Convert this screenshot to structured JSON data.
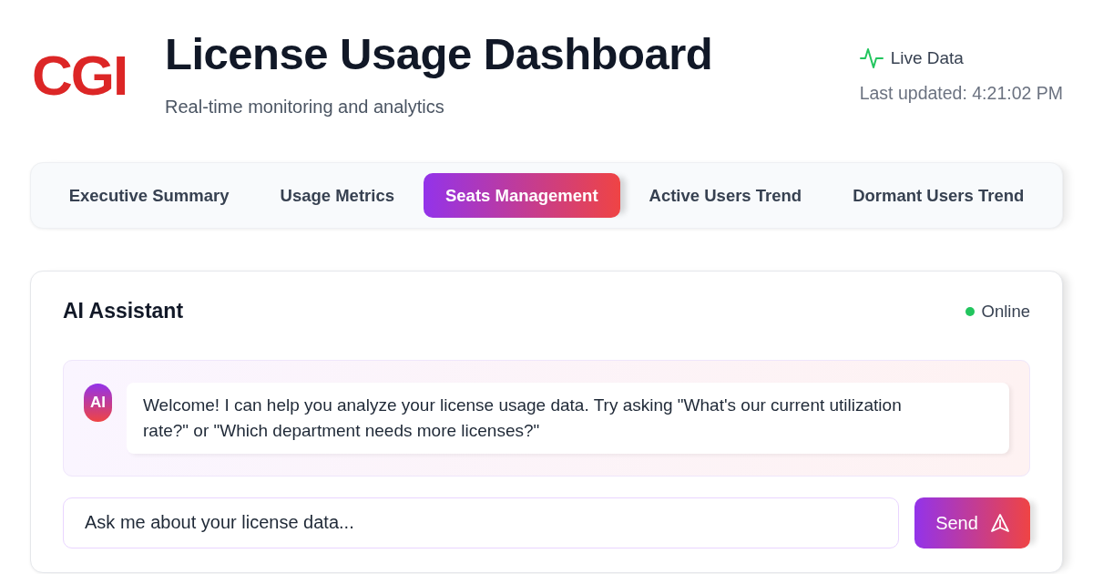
{
  "header": {
    "logo": "CGI",
    "title": "License Usage Dashboard",
    "subtitle": "Real-time monitoring and analytics",
    "live_label": "Live Data",
    "last_updated": "Last updated: 4:21:02 PM"
  },
  "tabs": [
    {
      "label": "Executive Summary",
      "selected": false
    },
    {
      "label": "Usage Metrics",
      "selected": false
    },
    {
      "label": "Seats Management",
      "selected": true
    },
    {
      "label": "Active Users Trend",
      "selected": false
    },
    {
      "label": "Dormant Users Trend",
      "selected": false
    }
  ],
  "assistant": {
    "title": "AI Assistant",
    "status": "Online",
    "messages": [
      {
        "kind": "assistant",
        "avatar": "AI",
        "text": "Welcome! I can help you analyze your license usage data. Try asking \"What's our current utilization rate?\" or \"Which department needs more licenses?\""
      }
    ],
    "input": {
      "placeholder": "Ask me about your license data..."
    },
    "send_button": {
      "label": "Send"
    }
  }
}
